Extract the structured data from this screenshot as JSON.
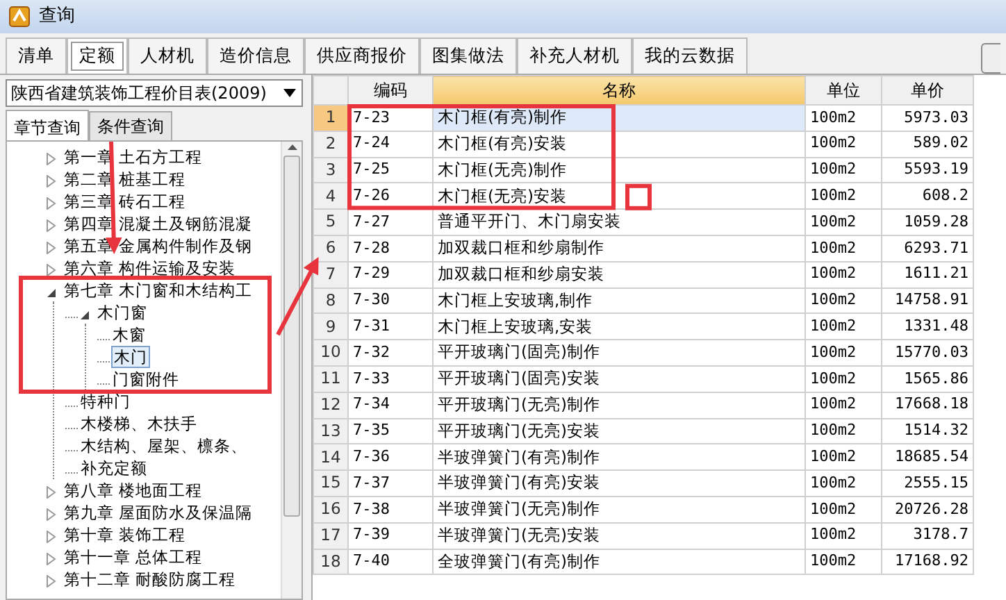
{
  "window": {
    "title": "查询"
  },
  "tabs": [
    {
      "label": "清单",
      "selected": false
    },
    {
      "label": "定额",
      "selected": true
    },
    {
      "label": "人材机",
      "selected": false
    },
    {
      "label": "造价信息",
      "selected": false
    },
    {
      "label": "供应商报价",
      "selected": false
    },
    {
      "label": "图集做法",
      "selected": false
    },
    {
      "label": "补充人材机",
      "selected": false
    },
    {
      "label": "我的云数据",
      "selected": false
    }
  ],
  "left_panel": {
    "library": {
      "value": "陕西省建筑装饰工程价目表(2009)"
    },
    "tabs": [
      {
        "label": "章节查询",
        "selected": true
      },
      {
        "label": "条件查询",
        "selected": false
      }
    ],
    "tree": [
      {
        "label": "第一章  土石方工程",
        "expanded": false,
        "selected": false
      },
      {
        "label": "第二章  桩基工程",
        "expanded": false,
        "selected": false
      },
      {
        "label": "第三章  砖石工程",
        "expanded": false,
        "selected": false
      },
      {
        "label": "第四章  混凝土及钢筋混凝",
        "expanded": false,
        "selected": false
      },
      {
        "label": "第五章  金属构件制作及钢",
        "expanded": false,
        "selected": false
      },
      {
        "label": "第六章  构件运输及安装",
        "expanded": false,
        "selected": false
      },
      {
        "label": "第七章  木门窗和木结构工",
        "expanded": true,
        "selected": false,
        "children": [
          {
            "label": "木门窗",
            "expanded": true,
            "selected": false,
            "children": [
              {
                "label": "木窗",
                "selected": false
              },
              {
                "label": "木门",
                "selected": true
              },
              {
                "label": "门窗附件",
                "selected": false
              }
            ]
          },
          {
            "label": "特种门",
            "selected": false
          },
          {
            "label": "木楼梯、木扶手",
            "selected": false
          },
          {
            "label": "木结构、屋架、檩条、",
            "selected": false
          },
          {
            "label": "补充定额",
            "selected": false
          }
        ]
      },
      {
        "label": "第八章  楼地面工程",
        "expanded": false,
        "selected": false
      },
      {
        "label": "第九章  屋面防水及保温隔",
        "expanded": false,
        "selected": false
      },
      {
        "label": "第十章  装饰工程",
        "expanded": false,
        "selected": false
      },
      {
        "label": "第十一章  总体工程",
        "expanded": false,
        "selected": false
      },
      {
        "label": "第十二章  耐酸防腐工程",
        "expanded": false,
        "selected": false
      }
    ]
  },
  "table": {
    "columns": [
      {
        "label": "编码",
        "selected": false
      },
      {
        "label": "名称",
        "selected": true
      },
      {
        "label": "单位",
        "selected": false
      },
      {
        "label": "单价",
        "selected": false
      }
    ],
    "rows": [
      {
        "number": "1",
        "code": "7-23",
        "name": "木门框(有亮)制作",
        "unit": "100m2",
        "price": "5973.03",
        "selected": true
      },
      {
        "number": "2",
        "code": "7-24",
        "name": "木门框(有亮)安装",
        "unit": "100m2",
        "price": "589.02",
        "selected": false
      },
      {
        "number": "3",
        "code": "7-25",
        "name": "木门框(无亮)制作",
        "unit": "100m2",
        "price": "5593.19",
        "selected": false
      },
      {
        "number": "4",
        "code": "7-26",
        "name": "木门框(无亮)安装",
        "unit": "100m2",
        "price": "608.2",
        "selected": false
      },
      {
        "number": "5",
        "code": "7-27",
        "name": "普通平开门、木门扇安装",
        "unit": "100m2",
        "price": "1059.28",
        "selected": false
      },
      {
        "number": "6",
        "code": "7-28",
        "name": "加双裁口框和纱扇制作",
        "unit": "100m2",
        "price": "6293.71",
        "selected": false
      },
      {
        "number": "7",
        "code": "7-29",
        "name": "加双裁口框和纱扇安装",
        "unit": "100m2",
        "price": "1611.21",
        "selected": false
      },
      {
        "number": "8",
        "code": "7-30",
        "name": "木门框上安玻璃,制作",
        "unit": "100m2",
        "price": "14758.91",
        "selected": false
      },
      {
        "number": "9",
        "code": "7-31",
        "name": "木门框上安玻璃,安装",
        "unit": "100m2",
        "price": "1331.48",
        "selected": false
      },
      {
        "number": "10",
        "code": "7-32",
        "name": "平开玻璃门(固亮)制作",
        "unit": "100m2",
        "price": "15770.03",
        "selected": false
      },
      {
        "number": "11",
        "code": "7-33",
        "name": "平开玻璃门(固亮)安装",
        "unit": "100m2",
        "price": "1565.86",
        "selected": false
      },
      {
        "number": "12",
        "code": "7-34",
        "name": "平开玻璃门(无亮)制作",
        "unit": "100m2",
        "price": "17668.18",
        "selected": false
      },
      {
        "number": "13",
        "code": "7-35",
        "name": "平开玻璃门(无亮)安装",
        "unit": "100m2",
        "price": "1514.32",
        "selected": false
      },
      {
        "number": "14",
        "code": "7-36",
        "name": "半玻弹簧门(有亮)制作",
        "unit": "100m2",
        "price": "18685.54",
        "selected": false
      },
      {
        "number": "15",
        "code": "7-37",
        "name": "半玻弹簧门(有亮)安装",
        "unit": "100m2",
        "price": "2555.15",
        "selected": false
      },
      {
        "number": "16",
        "code": "7-38",
        "name": "半玻弹簧门(无亮)制作",
        "unit": "100m2",
        "price": "20726.28",
        "selected": false
      },
      {
        "number": "17",
        "code": "7-39",
        "name": "半玻弹簧门(无亮)安装",
        "unit": "100m2",
        "price": "3178.7",
        "selected": false
      },
      {
        "number": "18",
        "code": "7-40",
        "name": "全玻弹簧门(有亮)制作",
        "unit": "100m2",
        "price": "17168.92",
        "selected": false
      }
    ]
  }
}
